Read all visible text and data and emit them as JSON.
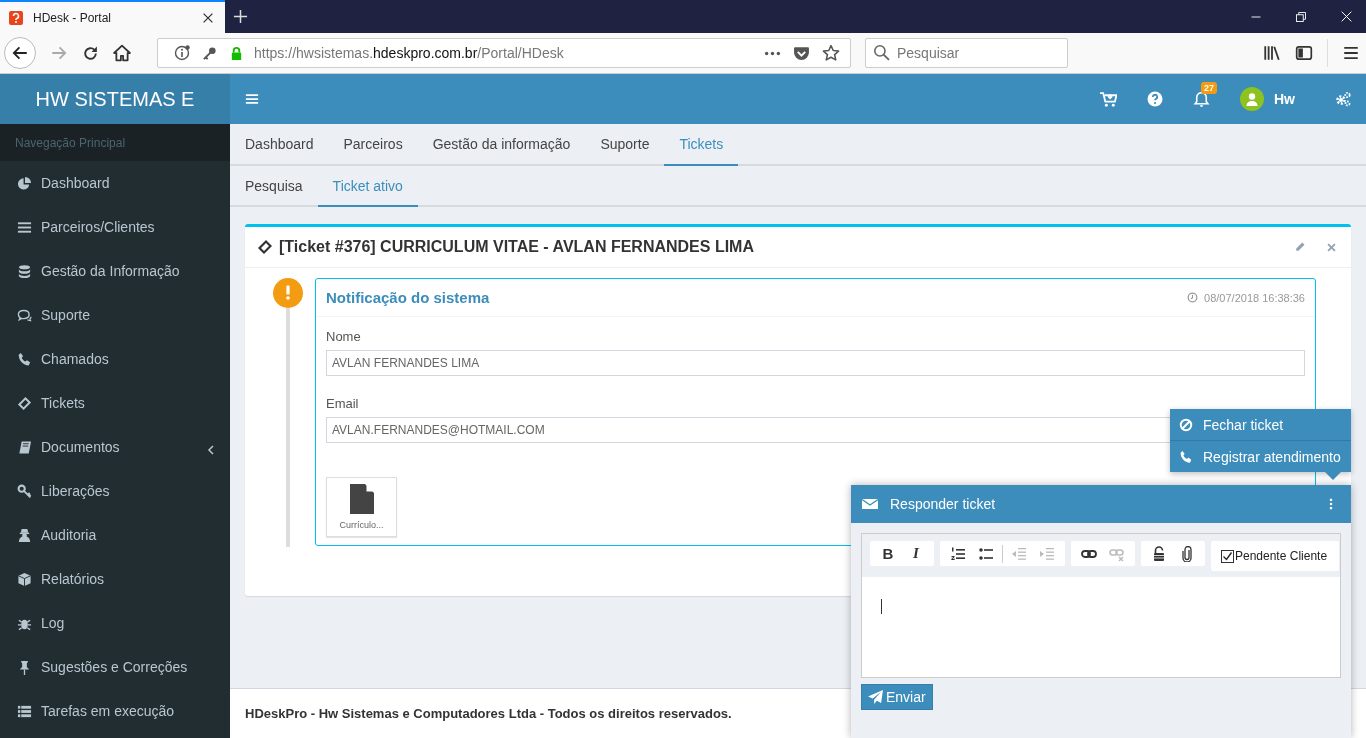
{
  "browser": {
    "tab": {
      "title": "HDesk - Portal"
    },
    "url": {
      "scheme": "https://hwsistemas.",
      "domain": "hdeskpro.com.br",
      "path": "/Portal/HDesk"
    },
    "search": {
      "placeholder": "Pesquisar"
    }
  },
  "app": {
    "logo": "HW SISTEMAS E",
    "notifications": "27",
    "user": "Hw"
  },
  "sidebar": {
    "header": "Navegação Principal",
    "items": [
      {
        "label": "Dashboard",
        "submenu": false
      },
      {
        "label": "Parceiros/Clientes",
        "submenu": false
      },
      {
        "label": "Gestão da Informação",
        "submenu": false
      },
      {
        "label": "Suporte",
        "submenu": false
      },
      {
        "label": "Chamados",
        "submenu": false
      },
      {
        "label": "Tickets",
        "submenu": false
      },
      {
        "label": "Documentos",
        "submenu": true
      },
      {
        "label": "Liberações",
        "submenu": false
      },
      {
        "label": "Auditoria",
        "submenu": false
      },
      {
        "label": "Relatórios",
        "submenu": false
      },
      {
        "label": "Log",
        "submenu": false
      },
      {
        "label": "Sugestões e Correções",
        "submenu": false
      },
      {
        "label": "Tarefas em execução",
        "submenu": false
      }
    ]
  },
  "tabs": [
    {
      "label": "Dashboard",
      "selected": false
    },
    {
      "label": "Parceiros",
      "selected": false
    },
    {
      "label": "Gestão da informação",
      "selected": false
    },
    {
      "label": "Suporte",
      "selected": false
    },
    {
      "label": "Tickets",
      "selected": true
    }
  ],
  "subtabs": [
    {
      "label": "Pesquisa",
      "selected": false
    },
    {
      "label": "Ticket ativo",
      "selected": true
    }
  ],
  "ticket": {
    "title": "[Ticket #376] CURRICULUM VITAE - AVLAN FERNANDES LIMA",
    "event": {
      "title": "Notificação do sistema",
      "time": "08/07/2018 16:38:36",
      "fields": [
        {
          "label": "Nome",
          "value": "AVLAN FERNANDES LIMA"
        },
        {
          "label": "Email",
          "value": "AVLAN.FERNANDES@HOTMAIL.COM"
        }
      ],
      "attachment": "Currículo..."
    }
  },
  "menu": [
    {
      "label": "Fechar ticket"
    },
    {
      "label": "Registrar atendimento"
    }
  ],
  "reply": {
    "title": "Responder ticket",
    "toolbar": [
      {
        "tools": [
          {
            "kind": "bold",
            "label": "B",
            "disabled": false
          },
          {
            "kind": "italic",
            "label": "I",
            "disabled": false
          }
        ]
      },
      {
        "tools": [
          {
            "kind": "ordered-list",
            "disabled": false
          },
          {
            "kind": "bullet-list",
            "disabled": false
          },
          {
            "kind": "outdent",
            "disabled": true
          },
          {
            "kind": "indent",
            "disabled": true
          }
        ]
      },
      {
        "tools": [
          {
            "kind": "link",
            "disabled": false
          },
          {
            "kind": "unlink",
            "disabled": true
          }
        ]
      },
      {
        "tools": [
          {
            "kind": "lock",
            "disabled": false
          },
          {
            "kind": "attach",
            "disabled": false
          }
        ]
      }
    ],
    "pending": {
      "label": "Pendente Cliente",
      "checked": true
    },
    "send": "Enviar"
  },
  "footer": "HDeskPro - Hw Sistemas e Computadores Ltda - Todos os direitos reservados."
}
